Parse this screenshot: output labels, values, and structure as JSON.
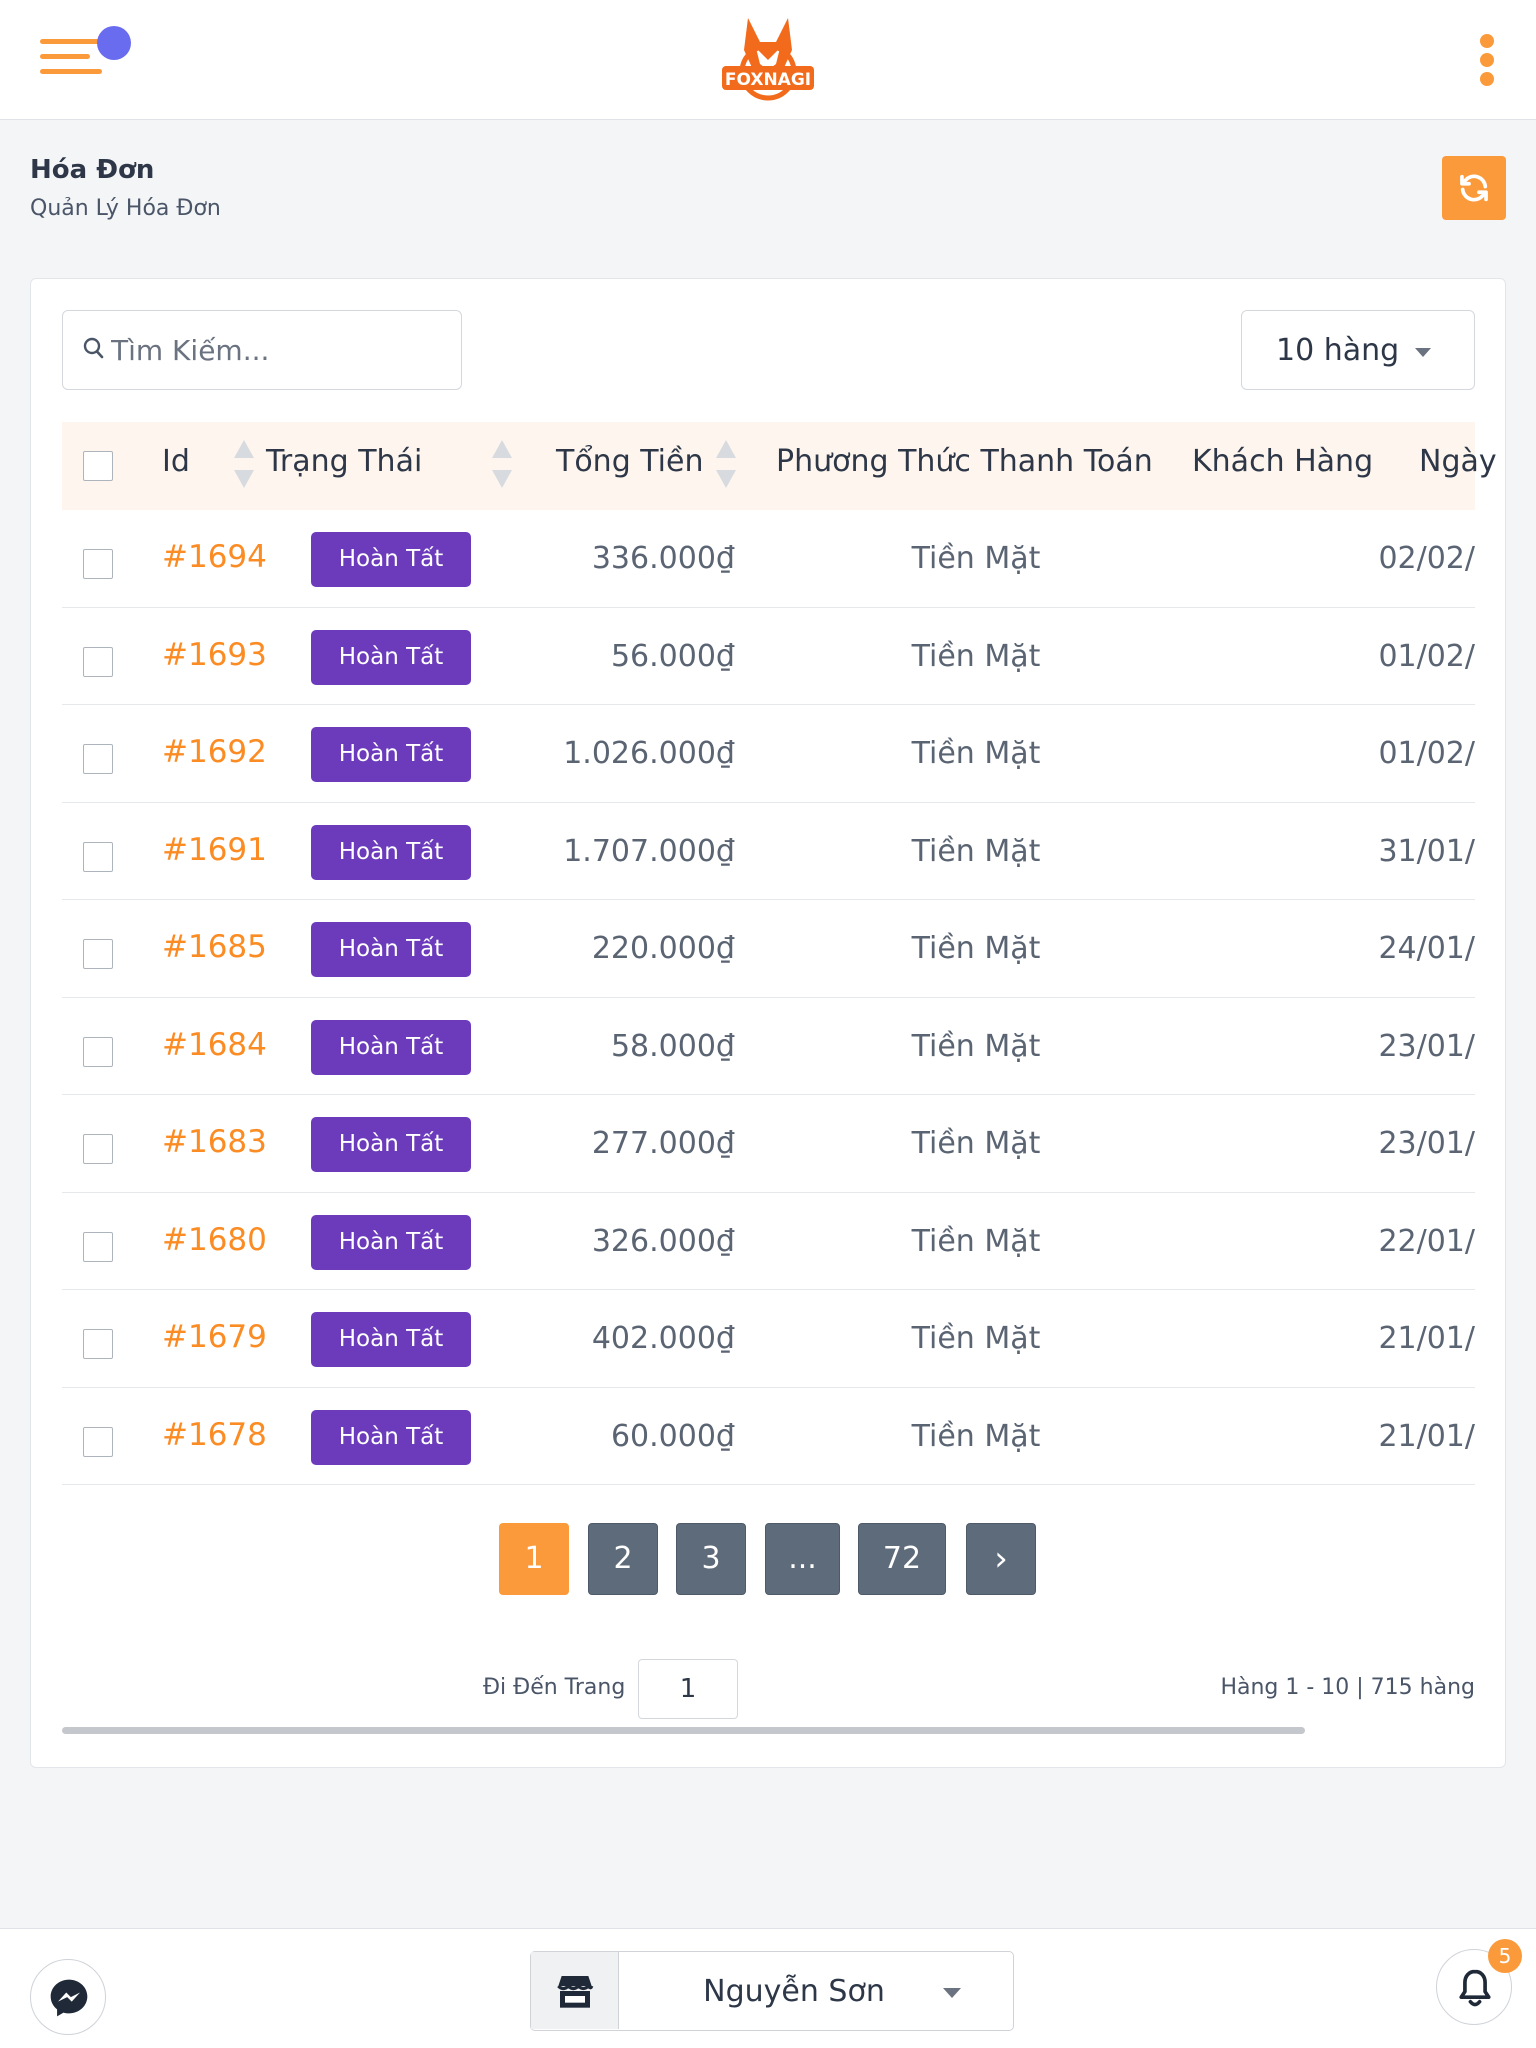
{
  "header": {
    "logo_text": "FOXNAGI",
    "menu_icon": "hamburger-menu-icon",
    "more_icon": "kebab-menu-icon"
  },
  "page": {
    "title": "Hóa Đơn",
    "subtitle": "Quản Lý Hóa Đơn",
    "refresh_icon": "refresh-icon"
  },
  "toolbar": {
    "search_placeholder": "Tìm Kiếm...",
    "rows_per_page_label": "10 hàng"
  },
  "table": {
    "columns": [
      "Id",
      "Trạng Thái",
      "Tổng Tiền",
      "Phương Thức Thanh Toán",
      "Khách Hàng",
      "Ngày"
    ],
    "rows": [
      {
        "id": "#1694",
        "status": "Hoàn Tất",
        "total": "336.000₫",
        "method": "Tiền Mặt",
        "customer": "",
        "date": "02/02/"
      },
      {
        "id": "#1693",
        "status": "Hoàn Tất",
        "total": "56.000₫",
        "method": "Tiền Mặt",
        "customer": "",
        "date": "01/02/"
      },
      {
        "id": "#1692",
        "status": "Hoàn Tất",
        "total": "1.026.000₫",
        "method": "Tiền Mặt",
        "customer": "",
        "date": "01/02/"
      },
      {
        "id": "#1691",
        "status": "Hoàn Tất",
        "total": "1.707.000₫",
        "method": "Tiền Mặt",
        "customer": "",
        "date": "31/01/"
      },
      {
        "id": "#1685",
        "status": "Hoàn Tất",
        "total": "220.000₫",
        "method": "Tiền Mặt",
        "customer": "",
        "date": "24/01/"
      },
      {
        "id": "#1684",
        "status": "Hoàn Tất",
        "total": "58.000₫",
        "method": "Tiền Mặt",
        "customer": "",
        "date": "23/01/"
      },
      {
        "id": "#1683",
        "status": "Hoàn Tất",
        "total": "277.000₫",
        "method": "Tiền Mặt",
        "customer": "",
        "date": "23/01/"
      },
      {
        "id": "#1680",
        "status": "Hoàn Tất",
        "total": "326.000₫",
        "method": "Tiền Mặt",
        "customer": "",
        "date": "22/01/"
      },
      {
        "id": "#1679",
        "status": "Hoàn Tất",
        "total": "402.000₫",
        "method": "Tiền Mặt",
        "customer": "",
        "date": "21/01/"
      },
      {
        "id": "#1678",
        "status": "Hoàn Tất",
        "total": "60.000₫",
        "method": "Tiền Mặt",
        "customer": "",
        "date": "21/01/"
      }
    ]
  },
  "pagination": {
    "pages": [
      "1",
      "2",
      "3",
      "...",
      "72"
    ],
    "active": "1",
    "next_label": "›",
    "goto_label": "Đi Đến Trang",
    "goto_value": "1",
    "summary": "Hàng 1 - 10 | 715 hàng"
  },
  "footer": {
    "store_name": "Nguyễn Sơn",
    "notification_count": "5",
    "messenger_icon": "messenger-icon",
    "store_icon": "store-icon",
    "bell_icon": "bell-icon"
  },
  "colors": {
    "accent": "#fb9a3b",
    "link": "#fb8c24",
    "badge": "#6c3bbc",
    "pager": "#5e6b7b",
    "menu_dot": "#6a6cf0"
  }
}
